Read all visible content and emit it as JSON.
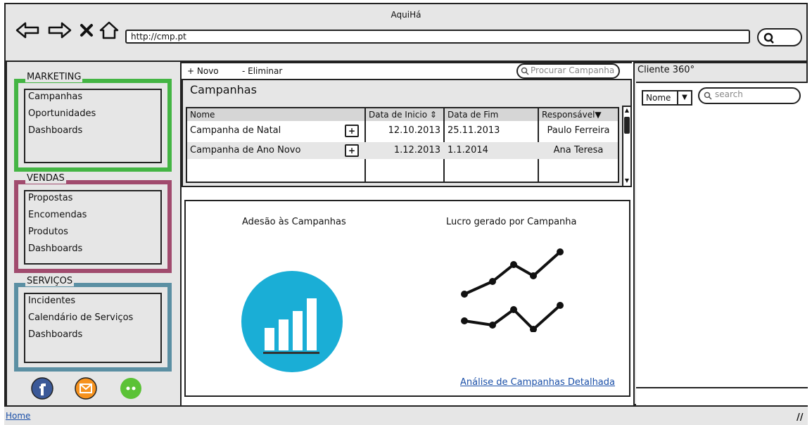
{
  "window": {
    "title": "AquiHá"
  },
  "browser": {
    "url": "http://cmp.pt",
    "nav_icons": [
      "back-arrow-icon",
      "forward-arrow-icon",
      "stop-icon",
      "home-icon"
    ]
  },
  "sidebar": {
    "groups": [
      {
        "title": "MARKETING",
        "color": "#44b544",
        "items": [
          "Campanhas",
          "Oportunidades",
          "Dashboards"
        ]
      },
      {
        "title": "VENDAS",
        "color": "#a14b6e",
        "items": [
          "Propostas",
          "Encomendas",
          "Produtos",
          "Dashboards"
        ]
      },
      {
        "title": "SERVIÇOS",
        "color": "#5b8fa3",
        "items": [
          "Incidentes",
          "Calendário de Serviços",
          "Dashboards"
        ]
      }
    ],
    "social_icons": [
      "facebook-icon",
      "mail-icon",
      "chat-icon"
    ]
  },
  "toolbar": {
    "new_label": "+ Novo",
    "delete_label": "- Eliminar",
    "search_placeholder": "Procurar Campanha"
  },
  "section_title": "Campanhas",
  "table": {
    "headers": [
      "Nome",
      "Data de Inicio",
      "Data de Fim",
      "Responsável"
    ],
    "rows": [
      {
        "nome": "Campanha de Natal",
        "inicio": "12.10.2013",
        "fim": "25.11.2013",
        "responsavel": "Paulo Ferreira"
      },
      {
        "nome": "Campanha de Ano Novo",
        "inicio": "1.12.2013",
        "fim": "1.1.2014",
        "responsavel": "Ana Teresa"
      }
    ]
  },
  "charts": {
    "left_title": "Adesão às Campanhas",
    "right_title": "Lucro gerado por Campanha",
    "link": "Análise de Campanhas Detalhada"
  },
  "right_panel": {
    "title": "Cliente 360°",
    "select_value": "Nome",
    "search_placeholder": "search"
  },
  "footer": {
    "home_link": "Home"
  },
  "colors": {
    "chart_circle": "#1aaed6"
  }
}
